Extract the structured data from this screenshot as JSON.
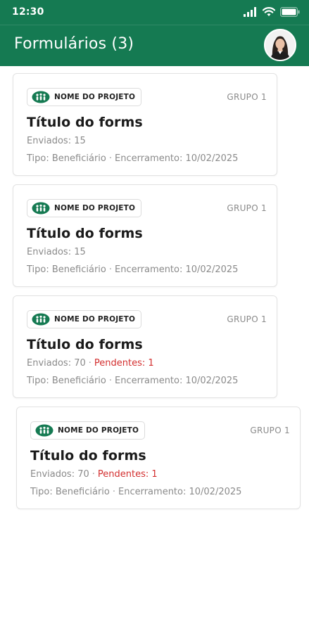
{
  "status_bar": {
    "time": "12:30"
  },
  "app_bar": {
    "title": "Formulários (3)"
  },
  "cards": [
    {
      "project": "NOME DO PROJETO",
      "group": "GRUPO 1",
      "title": "Título do forms",
      "sent": "Enviados: 15",
      "pending": "",
      "type": "Tipo: Beneficiário",
      "deadline": "Encerramento: 10/02/2025"
    },
    {
      "project": "NOME DO PROJETO",
      "group": "GRUPO 1",
      "title": "Título do forms",
      "sent": "Enviados: 15",
      "pending": "",
      "type": "Tipo: Beneficiário",
      "deadline": "Encerramento: 10/02/2025"
    },
    {
      "project": "NOME DO PROJETO",
      "group": "GRUPO 1",
      "title": "Título do forms",
      "sent": "Enviados: 70",
      "pending": "Pendentes: 1",
      "type": "Tipo: Beneficiário",
      "deadline": "Encerramento: 10/02/2025"
    },
    {
      "project": "NOME DO PROJETO",
      "group": "GRUPO 1",
      "title": "Título do forms",
      "sent": "Enviados: 70",
      "pending": "Pendentes: 1",
      "type": "Tipo: Beneficiário",
      "deadline": "Encerramento: 10/02/2025"
    }
  ],
  "icons": {
    "signal": "signal-icon",
    "wifi": "wifi-icon",
    "battery": "battery-icon",
    "project": "project-logo-icon",
    "avatar": "avatar"
  },
  "colors": {
    "brand": "#157a52",
    "pending": "#d32f2f",
    "muted": "#8a8a8a"
  }
}
